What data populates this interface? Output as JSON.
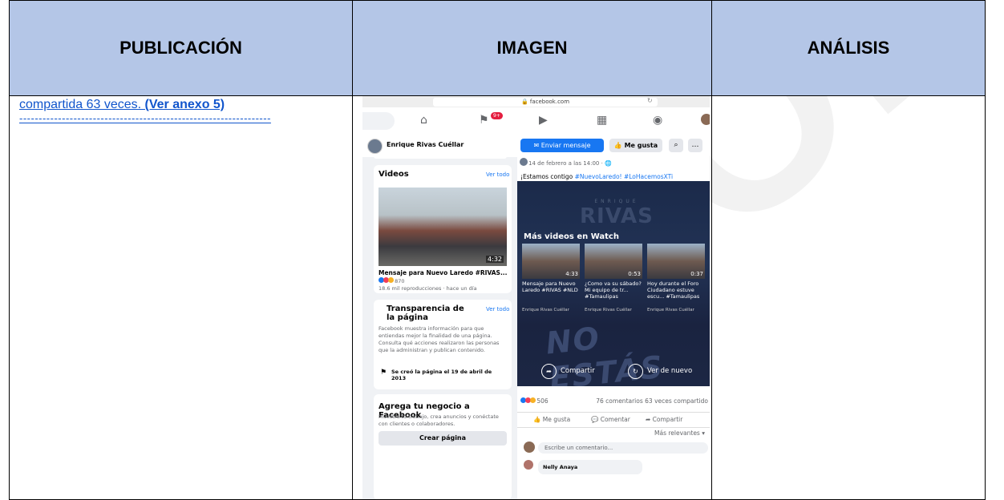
{
  "watermark": "COPIA",
  "table": {
    "headers": [
      "PUBLICACIÓN",
      "IMAGEN",
      "ANÁLISIS"
    ],
    "publicacion": {
      "text": "compartida 63 veces. ",
      "link_text": "(Ver anexo 5)",
      "dashes": "-----------------------------------------------------------------"
    },
    "analisis": ""
  },
  "screenshot": {
    "url": "facebook.com",
    "nav_badge": "9+",
    "page_name": "Enrique Rivas Cuéllar",
    "btn_message": "Enviar mensaje",
    "btn_like": "Me gusta",
    "videos_card": {
      "title": "Videos",
      "see_all": "Ver todo",
      "duration": "4:32",
      "video_title": "Mensaje para Nuevo Laredo #RIVAS...",
      "reactions": "870",
      "meta": "18.6 mil reproducciones · hace un día"
    },
    "transparency_card": {
      "title": "Transparencia de la página",
      "see_all": "Ver todo",
      "body": "Facebook muestra información para que entiendas mejor la finalidad de una página. Consulta qué acciones realizaron las personas que la administran y publican contenido.",
      "created": "Se creó la página el 19 de abril de 2013"
    },
    "business_card": {
      "title": "Agrega tu negocio a Facebook",
      "body": "Muestra tu trabajo, crea anuncios y conéctate con clientes o colaboradores.",
      "button": "Crear página"
    },
    "post": {
      "date": "14 de febrero a las 14:00 · ",
      "text": "¡Estamos contigo ",
      "hashtags": "#NuevoLaredo! #LoHacemosXTi",
      "video_brand_small": "ENRIQUE",
      "video_brand": "RIVAS",
      "watch_title": "Más videos en Watch",
      "watch_items": [
        {
          "duration": "4:33",
          "caption": "Mensaje para Nuevo Laredo #RIVAS #NLD",
          "source": "Enrique Rivas Cuéllar"
        },
        {
          "duration": "0:53",
          "caption": "¿Como va su sábado? Mi equipo de tr... #Tamaulipas",
          "source": "Enrique Rivas Cuéllar"
        },
        {
          "duration": "0:37",
          "caption": "Hoy durante el Foro Ciudadano estuve escu... #Tamaulipas",
          "source": "Enrique Rivas Cuéllar"
        }
      ],
      "overlay_text": "NO ESTÁS SOLOS",
      "share_label": "Compartir",
      "replay_label": "Ver de nuevo",
      "reactions_count": "506",
      "comments_shares": "76 comentarios  63 veces compartido",
      "actions": [
        "Me gusta",
        "Comentar",
        "Compartir"
      ],
      "most_relevant": "Más relevantes ▾",
      "comment_placeholder": "Escribe un comentario...",
      "commenter": "Nelly Anaya"
    }
  }
}
